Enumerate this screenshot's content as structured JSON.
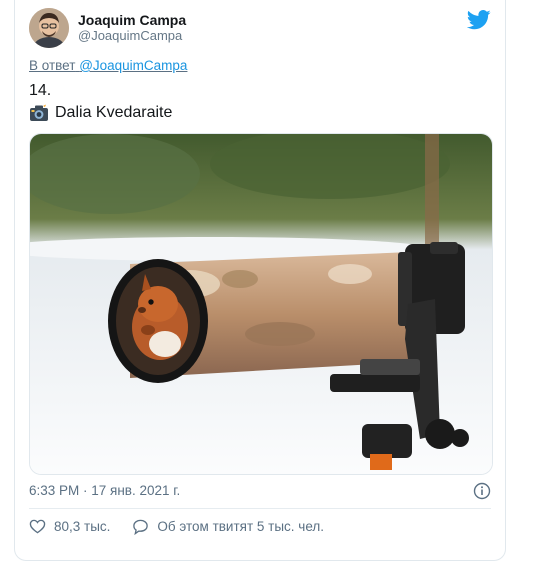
{
  "author": {
    "name": "Joaquim Campa",
    "handle": "@JoaquimCampa"
  },
  "reply": {
    "prefix": "В ответ",
    "handle": "@JoaquimCampa"
  },
  "tweet": {
    "number": "14.",
    "credit": "Dalia Kvedaraite"
  },
  "meta": {
    "timestamp": "6:33 PM · 17 янв. 2021 г."
  },
  "actions": {
    "likes": "80,3 тыс.",
    "comments": "Об этом твитят 5 тыс. чел."
  },
  "colors": {
    "brand": "#1da1f2",
    "like": "#5b7083"
  },
  "icons": [
    "twitter-bird-icon",
    "camera-icon",
    "info-icon",
    "heart-icon",
    "comment-icon"
  ]
}
